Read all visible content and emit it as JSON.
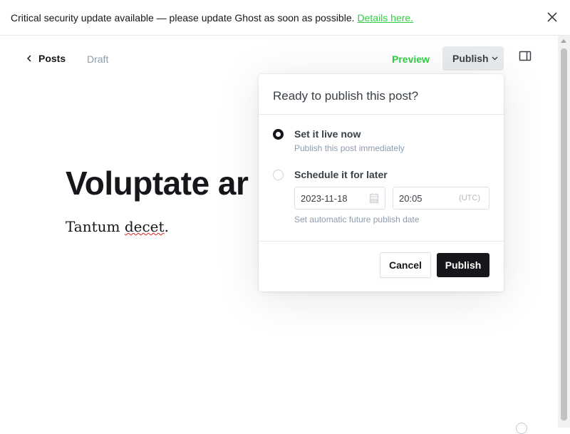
{
  "banner": {
    "message": "Critical security update available — please update Ghost as soon as possible.",
    "link_text": "Details here."
  },
  "editor": {
    "back_label": "Posts",
    "status": "Draft",
    "preview_label": "Preview",
    "publish_label": "Publish",
    "title": "Voluptate ar",
    "body": "Tantum ",
    "body_misspelled": "decet",
    "body_end": "."
  },
  "publish_menu": {
    "heading": "Ready to publish this post?",
    "options": [
      {
        "label": "Set it live now",
        "hint": "Publish this post immediately",
        "selected": true
      },
      {
        "label": "Schedule it for later",
        "hint": "Set automatic future publish date",
        "selected": false
      }
    ],
    "date_value": "2023-11-18",
    "time_value": "20:05",
    "timezone": "(UTC)",
    "cancel_label": "Cancel",
    "publish_label": "Publish"
  },
  "colors": {
    "accent_green": "#30cf43",
    "primary_dark": "#15171a"
  }
}
